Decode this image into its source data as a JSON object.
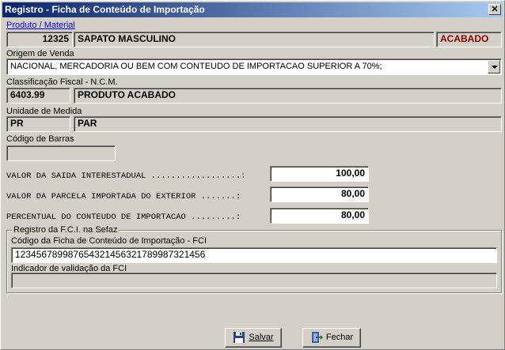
{
  "window": {
    "title": "Registro - Ficha de Conteúdo de Importação",
    "close_glyph": "✕"
  },
  "produto": {
    "label": "Produto / Material",
    "code": "12325",
    "name": "SAPATO MASCULINO",
    "status": "ACABADO",
    "status_color": "#8b0000"
  },
  "origem": {
    "label": "Origem de Venda",
    "selected": "NACIONAL, MERCADORIA OU BEM COM CONTEUDO DE IMPORTACAO SUPERIOR A 70%;"
  },
  "ncm": {
    "label": "Classificação Fiscal - N.C.M.",
    "code": "6403.99",
    "description": "PRODUTO ACABADO"
  },
  "unidade": {
    "label": "Unidade de Medida",
    "code": "PR",
    "description": "PAR"
  },
  "barras": {
    "label": "Código de Barras",
    "value": ""
  },
  "valores": {
    "saida_label": "VALOR DA SAIDA INTERESTADUAL ..................:",
    "saida_value": "100,00",
    "parcela_label": "VALOR DA PARCELA IMPORTADA DO EXTERIOR .......:",
    "parcela_value": "80,00",
    "percentual_label": "PERCENTUAL DO CONTEUDO DE IMPORTACAO .........:",
    "percentual_value": "80,00"
  },
  "fci": {
    "group_title": "Registro da F.C.I. na Sefaz",
    "codigo_label": "Código da Ficha de Conteúdo de Importação - FCI",
    "codigo_value": "123456789987654321456321789987321456",
    "indicador_label": "Indicador de validação da FCI",
    "indicador_value": ""
  },
  "buttons": {
    "save_label": "Salvar",
    "close_label": "Fechar",
    "save_icon": "floppy-disk-icon",
    "close_icon": "exit-door-icon"
  }
}
